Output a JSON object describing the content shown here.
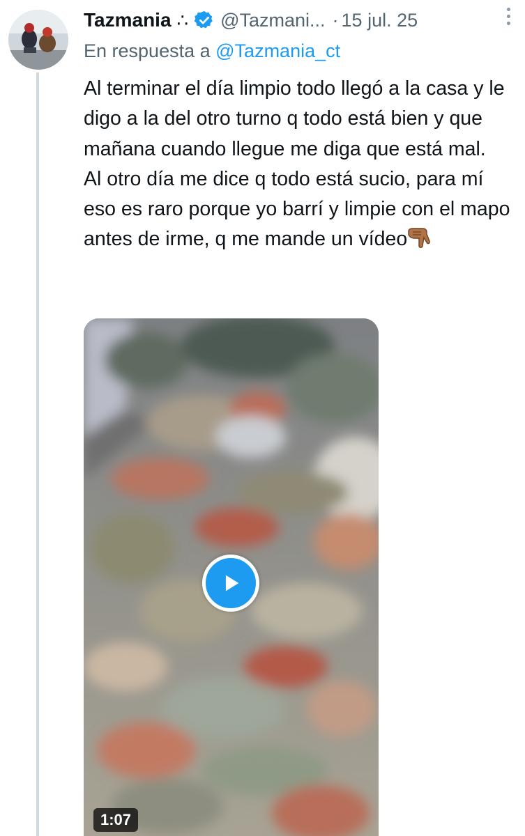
{
  "tweet": {
    "display_name": "Tazmania",
    "name_symbol": "∴",
    "handle": "@Tazmani...",
    "separator": "·",
    "date": "15 jul. 25",
    "reply_prefix": "En respuesta a",
    "reply_mention": "@Tazmania_ct",
    "text": "Al terminar el día limpio todo llegó a la casa y le digo a la del otro turno q todo está bien y que mañana cuando llegue me diga que está mal.\nAl otro día me dice q todo está sucio, para mí eso es raro porque yo barrí y limpie con el mapo antes de irme, q me mande un vídeo",
    "emoji": "backhand-index-pointing-down",
    "video_duration": "1:07"
  },
  "icons": {
    "verified": "verified-badge-icon",
    "more": "more-options-icon",
    "play": "play-icon"
  },
  "colors": {
    "text": "#0f1419",
    "secondary": "#536471",
    "accent": "#1d9bf0",
    "thread_line": "#cfd9de"
  }
}
